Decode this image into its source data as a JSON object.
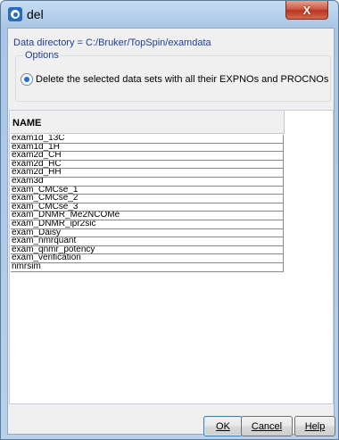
{
  "window": {
    "title": "del",
    "close_symbol": "X",
    "icon": "topspin-app-icon"
  },
  "data_directory": "Data directory = C:/Bruker/TopSpin/examdata",
  "options": {
    "label": "Options",
    "radio_label": "Delete the selected data sets with all their EXPNOs and PROCNOs",
    "radio_selected": true
  },
  "table": {
    "column_header": "NAME",
    "rows": [
      "exam1d_13C",
      "exam1d_1H",
      "exam2d_CH",
      "exam2d_HC",
      "exam2d_HH",
      "exam3d",
      "exam_CMCse_1",
      "exam_CMCse_2",
      "exam_CMCse_3",
      "exam_DNMR_Me2NCOMe",
      "exam_DNMR_ipr2sic",
      "exam_Daisy",
      "exam_nmrquant",
      "exam_qnmr_potency",
      "exam_verification",
      "nmrsim"
    ]
  },
  "buttons": {
    "ok": "OK",
    "cancel": "Cancel",
    "help": "Help"
  }
}
